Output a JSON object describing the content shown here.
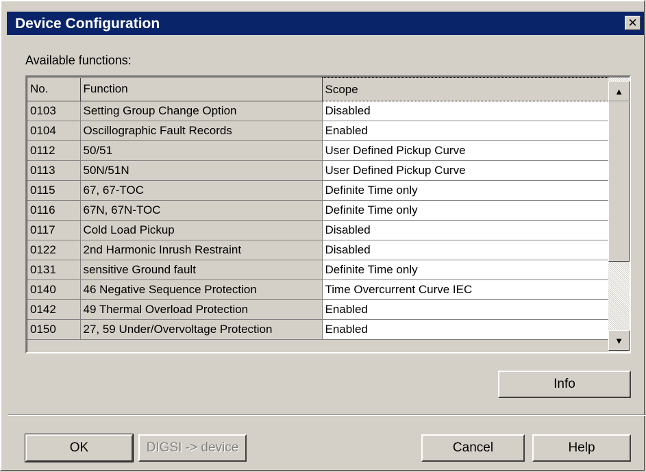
{
  "window": {
    "title": "Device Configuration",
    "close_glyph": "✕"
  },
  "available_label": "Available functions:",
  "table": {
    "headers": [
      "No.",
      "Function",
      "Scope"
    ],
    "rows": [
      {
        "no": "0103",
        "function": "Setting Group Change Option",
        "scope": "Disabled"
      },
      {
        "no": "0104",
        "function": "Oscillographic Fault Records",
        "scope": "Enabled"
      },
      {
        "no": "0112",
        "function": "50/51",
        "scope": "User Defined Pickup Curve"
      },
      {
        "no": "0113",
        "function": "50N/51N",
        "scope": "User Defined Pickup Curve"
      },
      {
        "no": "0115",
        "function": "67, 67-TOC",
        "scope": "Definite Time only"
      },
      {
        "no": "0116",
        "function": "67N, 67N-TOC",
        "scope": "Definite Time only"
      },
      {
        "no": "0117",
        "function": "Cold Load Pickup",
        "scope": "Disabled"
      },
      {
        "no": "0122",
        "function": "2nd Harmonic Inrush Restraint",
        "scope": "Disabled"
      },
      {
        "no": "0131",
        "function": "sensitive Ground fault",
        "scope": "Definite Time only"
      },
      {
        "no": "0140",
        "function": "46 Negative Sequence  Protection",
        "scope": "Time Overcurrent Curve IEC"
      },
      {
        "no": "0142",
        "function": "49 Thermal Overload Protection",
        "scope": "Enabled"
      },
      {
        "no": "0150",
        "function": "27, 59  Under/Overvoltage Protection",
        "scope": "Enabled"
      }
    ]
  },
  "buttons": {
    "info": "Info",
    "ok": "OK",
    "digsi": "DIGSI -> device",
    "cancel": "Cancel",
    "help": "Help"
  },
  "icons": {
    "close": "close-icon",
    "scroll_up": "arrow-up-icon",
    "scroll_down": "arrow-down-icon"
  },
  "colors": {
    "titlebar": "#0a246a",
    "face": "#d4d0c8",
    "cell_white": "#ffffff"
  }
}
